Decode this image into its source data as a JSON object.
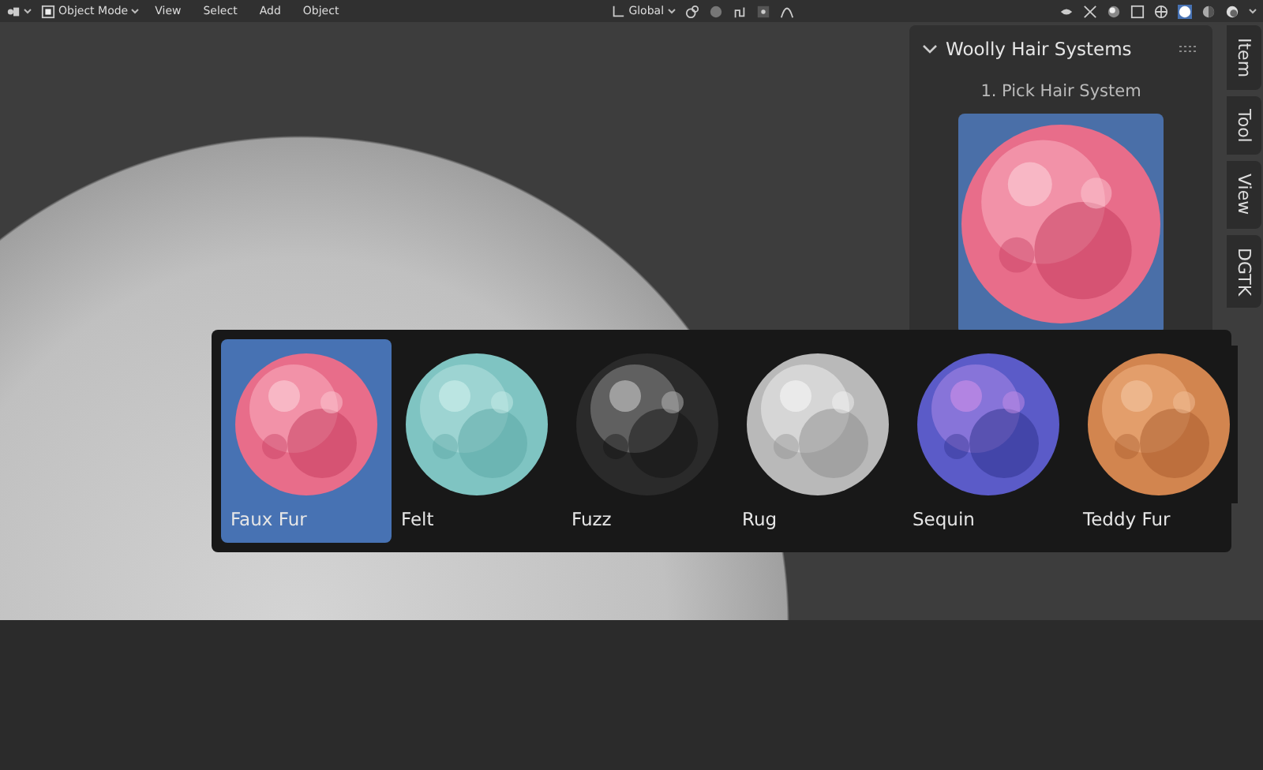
{
  "header": {
    "mode": "Object Mode",
    "menus": [
      "View",
      "Select",
      "Add",
      "Object"
    ],
    "orientation": "Global"
  },
  "sidebar": {
    "panel_title": "Woolly Hair Systems",
    "expanded": true,
    "step_label": "1. Pick Hair System",
    "tabs": [
      {
        "label": "Item",
        "selected": false
      },
      {
        "label": "Tool",
        "selected": false
      },
      {
        "label": "View",
        "selected": false
      },
      {
        "label": "DGTK",
        "selected": false
      }
    ]
  },
  "popup": {
    "items": [
      {
        "label": "Faux Fur",
        "selected": true
      },
      {
        "label": "Felt",
        "selected": false
      },
      {
        "label": "Fuzz",
        "selected": false
      },
      {
        "label": "Rug",
        "selected": false
      },
      {
        "label": "Sequin",
        "selected": false
      },
      {
        "label": "Teddy Fur",
        "selected": false
      }
    ]
  }
}
